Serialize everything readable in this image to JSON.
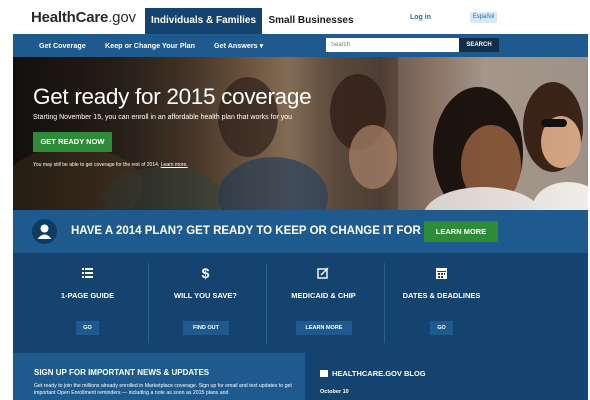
{
  "header": {
    "logo_main": "HealthCare",
    "logo_dot": ".",
    "logo_tld": "gov",
    "tab_active": "Individuals & Families",
    "tab_other": "Small Businesses",
    "login": "Log in",
    "espanol": "Español"
  },
  "nav": {
    "items": [
      "Get Coverage",
      "Keep or Change Your Plan",
      "Get Answers ▾"
    ],
    "search_placeholder": "Search",
    "search_button": "SEARCH"
  },
  "hero": {
    "title": "Get ready for 2015 coverage",
    "subtitle": "Starting November 15, you can enroll in an affordable health plan that works for you",
    "button": "GET READY NOW",
    "note": "You may still be able to get coverage for the rest of 2014.",
    "note_link": "Learn more."
  },
  "band": {
    "text": "HAVE A 2014 PLAN? GET READY TO KEEP OR CHANGE IT FOR 2015",
    "button": "LEARN MORE"
  },
  "features": [
    {
      "icon": "list-icon",
      "label": "1-PAGE GUIDE",
      "button": "GO"
    },
    {
      "icon": "dollar-icon",
      "label": "WILL YOU SAVE?",
      "button": "FIND OUT"
    },
    {
      "icon": "edit-icon",
      "label": "MEDICAID & CHIP",
      "button": "LEARN MORE"
    },
    {
      "icon": "calendar-icon",
      "label": "DATES & DEADLINES",
      "button": "GO"
    }
  ],
  "signup": {
    "title": "SIGN UP FOR IMPORTANT NEWS & UPDATES",
    "text": "Get ready to join the millions already enrolled in Marketplace coverage. Sign up for email and text updates to get important Open Enrollment reminders — including a note as soon as 2015 plans and"
  },
  "blog": {
    "title": "HEALTHCARE.GOV BLOG",
    "date": "October 10"
  },
  "colors": {
    "navy": "#13436e",
    "blue": "#1f5a8f",
    "green": "#2e8b38"
  }
}
